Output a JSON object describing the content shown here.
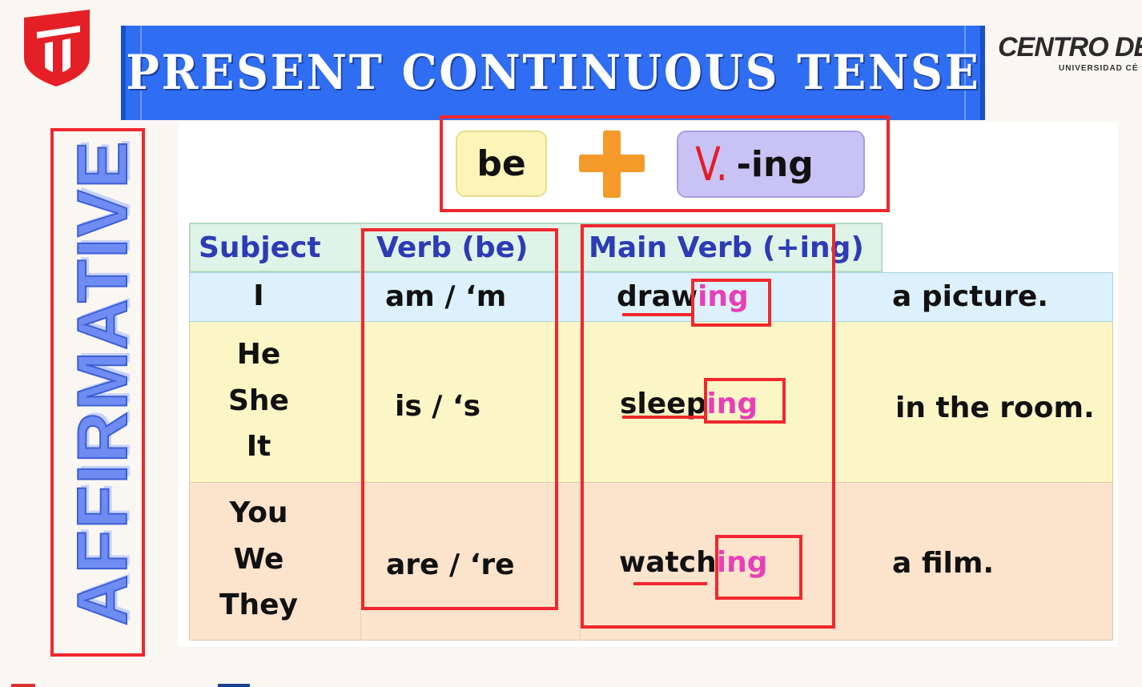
{
  "header": {
    "title": "PRESENT CONTINUOUS TENSE",
    "brand_name": "CENTRO DE",
    "brand_sub": "UNIVERSIDAD CÉ"
  },
  "side_label": "AFFIRMATIVE",
  "formula": {
    "left": "be",
    "right_suffix": "-ing",
    "handwritten_mark": "V."
  },
  "table": {
    "headers": [
      "Subject",
      "Verb (be)",
      "Main Verb (+ing)"
    ],
    "rows": [
      {
        "subjects": [
          "I"
        ],
        "be": "am / ‘m",
        "verb_stem": "draw",
        "verb_suffix": "ing",
        "complement": "a picture."
      },
      {
        "subjects": [
          "He",
          "She",
          "It"
        ],
        "be": "is / ‘s",
        "verb_stem": "sleep",
        "verb_suffix": "ing",
        "complement": "in the room."
      },
      {
        "subjects": [
          "You",
          "We",
          "They"
        ],
        "be": "are / ‘re",
        "verb_stem": "watch",
        "verb_suffix": "ing",
        "complement": "a film."
      }
    ]
  },
  "colors": {
    "banner": "#2f6ef2",
    "annotation_red": "#f0282d",
    "header_text": "#2d3bb4",
    "ing_highlight": "#e83fb8",
    "plus_orange": "#f39a2a"
  },
  "icons": {
    "logo": "university-shield-icon",
    "plus": "plus-icon"
  }
}
